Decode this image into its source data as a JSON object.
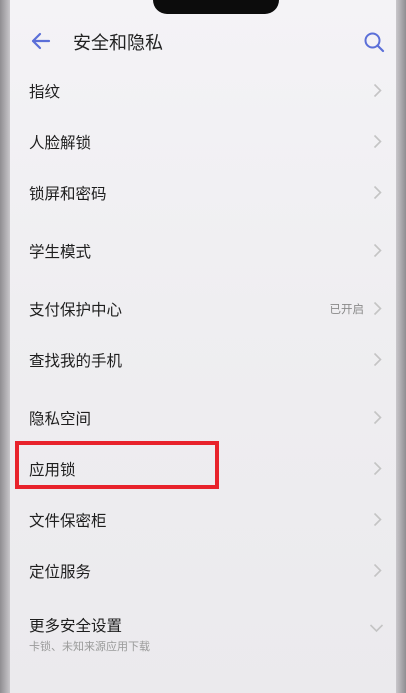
{
  "header": {
    "title": "安全和隐私",
    "back_icon": "back-arrow-icon",
    "search_icon": "search-icon",
    "accent_color": "#5b6fd8"
  },
  "list": {
    "items": [
      {
        "label": "指纹",
        "status": ""
      },
      {
        "label": "人脸解锁",
        "status": ""
      },
      {
        "label": "锁屏和密码",
        "status": ""
      },
      {
        "label": "学生模式",
        "status": ""
      },
      {
        "label": "支付保护中心",
        "status": "已开启"
      },
      {
        "label": "查找我的手机",
        "status": ""
      },
      {
        "label": "隐私空间",
        "status": ""
      },
      {
        "label": "应用锁",
        "status": ""
      },
      {
        "label": "文件保密柜",
        "status": ""
      },
      {
        "label": "定位服务",
        "status": ""
      }
    ],
    "more": {
      "label": "更多安全设置",
      "subtitle": "卡锁、未知来源应用下载"
    }
  },
  "highlight_color": "#e8222b"
}
